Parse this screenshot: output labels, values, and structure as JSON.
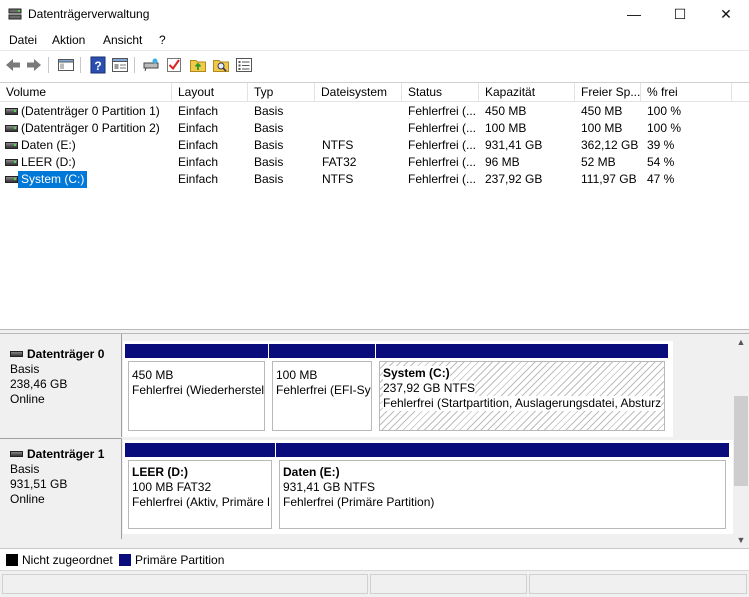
{
  "window": {
    "title": "Datenträgerverwaltung",
    "minimize": "—",
    "maximize": "☐",
    "close": "✕"
  },
  "menu": [
    "Datei",
    "Aktion",
    "Ansicht",
    "?"
  ],
  "toolbar": {
    "buttons": [
      "back-icon",
      "forward-icon",
      "console-tree-icon",
      "help-icon",
      "properties-icon",
      "connect-icon",
      "check-icon",
      "folder-up-icon",
      "search-folder-icon",
      "list-view-icon"
    ]
  },
  "volumes": {
    "columns": [
      "Volume",
      "Layout",
      "Typ",
      "Dateisystem",
      "Status",
      "Kapazität",
      "Freier Sp...",
      "% frei"
    ],
    "rows": [
      {
        "volume": "(Datenträger 0 Partition 1)",
        "layout": "Einfach",
        "typ": "Basis",
        "fs": "",
        "status": "Fehlerfrei (...",
        "cap": "450 MB",
        "free": "450 MB",
        "pct": "100 %"
      },
      {
        "volume": "(Datenträger 0 Partition 2)",
        "layout": "Einfach",
        "typ": "Basis",
        "fs": "",
        "status": "Fehlerfrei (...",
        "cap": "100 MB",
        "free": "100 MB",
        "pct": "100 %"
      },
      {
        "volume": "Daten (E:)",
        "layout": "Einfach",
        "typ": "Basis",
        "fs": "NTFS",
        "status": "Fehlerfrei (...",
        "cap": "931,41 GB",
        "free": "362,12 GB",
        "pct": "39 %"
      },
      {
        "volume": "LEER (D:)",
        "layout": "Einfach",
        "typ": "Basis",
        "fs": "FAT32",
        "status": "Fehlerfrei (...",
        "cap": "96 MB",
        "free": "52 MB",
        "pct": "54 %"
      },
      {
        "volume": "System (C:)",
        "layout": "Einfach",
        "typ": "Basis",
        "fs": "NTFS",
        "status": "Fehlerfrei (...",
        "cap": "237,92 GB",
        "free": "111,97 GB",
        "pct": "47 %"
      }
    ]
  },
  "disks": [
    {
      "name": "Datenträger 0",
      "type": "Basis",
      "size": "238,46 GB",
      "state": "Online",
      "partitions": [
        {
          "name": "",
          "size": "450 MB",
          "status": "Fehlerfrei (Wiederherstel"
        },
        {
          "name": "",
          "size": "100 MB",
          "status": "Fehlerfrei (EFI-Sys"
        },
        {
          "name": "System  (C:)",
          "size": "237,92 GB NTFS",
          "status": "Fehlerfrei (Startpartition, Auslagerungsdatei, Absturz"
        }
      ]
    },
    {
      "name": "Datenträger 1",
      "type": "Basis",
      "size": "931,51 GB",
      "state": "Online",
      "partitions": [
        {
          "name": "LEER  (D:)",
          "size": "100 MB FAT32",
          "status": "Fehlerfrei (Aktiv, Primäre l"
        },
        {
          "name": "Daten  (E:)",
          "size": "931,41 GB NTFS",
          "status": "Fehlerfrei (Primäre Partition)"
        }
      ]
    }
  ],
  "legend": [
    {
      "label": "Nicht zugeordnet",
      "color": "#000000"
    },
    {
      "label": "Primäre Partition",
      "color": "#0a0c7c"
    }
  ],
  "colors": {
    "primary_partition": "#0a0c7c",
    "selection": "#0078d7"
  }
}
